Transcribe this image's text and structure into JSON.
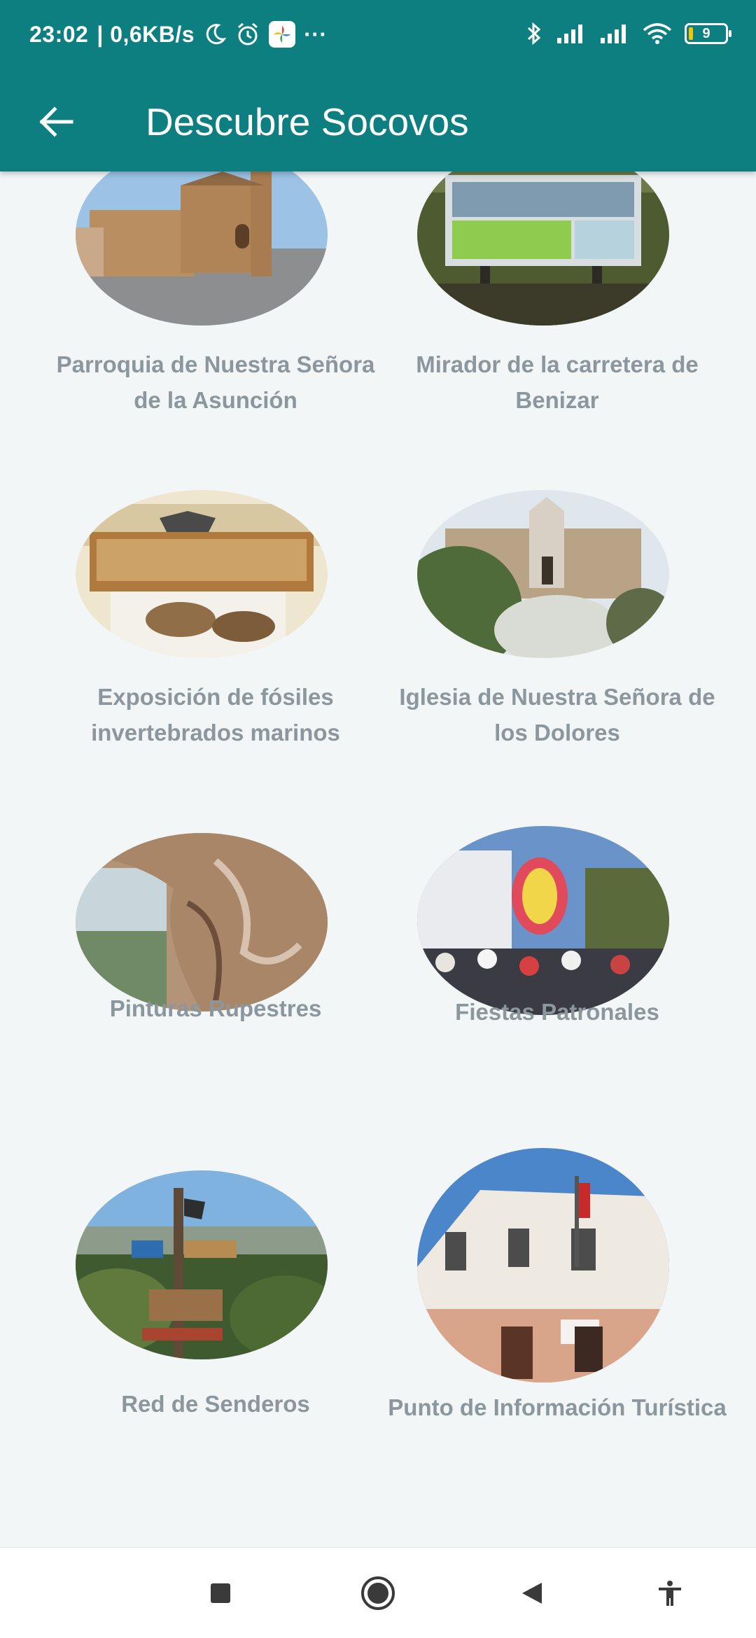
{
  "status_bar": {
    "time": "23:02",
    "speed": "| 0,6KB/s",
    "more": "···",
    "battery_level": "9"
  },
  "toolbar": {
    "title": "Descubre Socovos"
  },
  "places": [
    {
      "label": "Parroquia de Nuestra Señora de la Asunción",
      "image": "church-photo"
    },
    {
      "label": "Mirador de la carretera de Benizar",
      "image": "viewpoint-sign-photo"
    },
    {
      "label": "Exposición de fósiles invertebrados marinos",
      "image": "fossil-exhibition-photo"
    },
    {
      "label": "Iglesia de Nuestra Señora de los Dolores",
      "image": "chapel-photo"
    },
    {
      "label": "Pinturas Rupestres",
      "image": "cave-paintings-photo"
    },
    {
      "label": "Fiestas Patronales",
      "image": "festival-procession-photo"
    },
    {
      "label": "Red de Senderos",
      "image": "trail-signpost-photo"
    },
    {
      "label": "Punto de Información Turística",
      "image": "town-hall-photo"
    }
  ],
  "colors": {
    "app_bar": "#0e7f80",
    "background": "#f3f6f7",
    "label_text": "#8b979d"
  },
  "nav_bar": {
    "icons": [
      "recents-square-icon",
      "home-circle-icon",
      "back-triangle-icon",
      "accessibility-icon"
    ]
  }
}
